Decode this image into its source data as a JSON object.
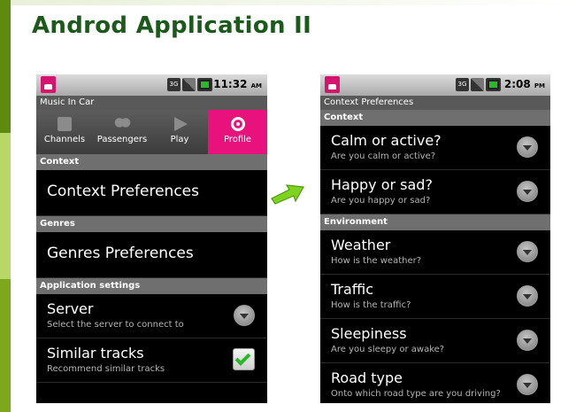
{
  "slide": {
    "title": "Androd Application II"
  },
  "left_screen": {
    "status": {
      "time": "11:32",
      "ampm": "AM",
      "network": "3G"
    },
    "title": "Music In Car",
    "tabs": [
      {
        "label": "Channels",
        "icon": "channels-icon"
      },
      {
        "label": "Passengers",
        "icon": "passengers-icon"
      },
      {
        "label": "Play",
        "icon": "play-icon"
      },
      {
        "label": "Profile",
        "icon": "profile-icon",
        "selected": true
      }
    ],
    "sections": {
      "context": "Context",
      "genres": "Genres",
      "application": "Application settings"
    },
    "items": {
      "context_prefs": "Context Preferences",
      "genres_prefs": "Genres Preferences",
      "server_title": "Server",
      "server_sub": "Select the server to connect to",
      "similar_title": "Similar tracks",
      "similar_sub": "Recommend similar tracks",
      "similar_checked": true
    }
  },
  "right_screen": {
    "status": {
      "time": "2:08",
      "ampm": "PM",
      "network": "3G"
    },
    "title": "Context Preferences",
    "sections": {
      "context": "Context",
      "environment": "Environment"
    },
    "items": [
      {
        "title": "Calm or active?",
        "sub": "Are you calm or active?"
      },
      {
        "title": "Happy or sad?",
        "sub": "Are you happy or sad?"
      },
      {
        "title": "Weather",
        "sub": "How is the weather?"
      },
      {
        "title": "Traffic",
        "sub": "How is the traffic?"
      },
      {
        "title": "Sleepiness",
        "sub": "Are you sleepy or awake?"
      },
      {
        "title": "Road type",
        "sub": "Onto which road type are you driving?"
      }
    ]
  },
  "colors": {
    "title_green": "#1b5a1b",
    "accent_pink": "#e9127d",
    "arrow_green": "#7ed321",
    "check_green": "#28b828"
  }
}
